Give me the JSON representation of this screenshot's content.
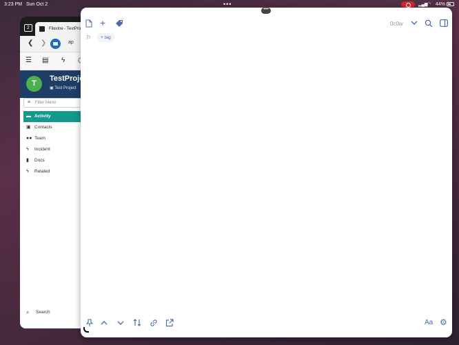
{
  "status_bar": {
    "time": "3:23 PM",
    "date": "Sun Oct 2",
    "battery": "44%",
    "recording_color": "#d3272b"
  },
  "browser": {
    "tab_count": "2",
    "tab_title": "Filevine - TestProje",
    "url_text": "ap",
    "project": {
      "avatar_letter": "T",
      "name": "TestProjec",
      "subtitle": "Test Project",
      "avatar_color": "#4caf50",
      "header_color": "#1e3e66"
    },
    "filter_placeholder": "Filter Menu",
    "menu": [
      {
        "label": "Activity",
        "icon": "chat-icon",
        "active": true
      },
      {
        "label": "Contacts",
        "icon": "contact-card-icon",
        "active": false
      },
      {
        "label": "Team",
        "icon": "people-icon",
        "active": false
      },
      {
        "label": "Incident",
        "icon": "bolt-icon",
        "active": false
      },
      {
        "label": "Docs",
        "icon": "document-icon",
        "active": false
      },
      {
        "label": "Related",
        "icon": "bolt-icon",
        "active": false
      }
    ],
    "search_label": "Search",
    "accent_color": "#129a8f"
  },
  "editor": {
    "word_count": "0c0w",
    "tag_button": "+ tag",
    "toolbar_top": [
      "new-document-icon",
      "plus-icon",
      "tag-icon"
    ],
    "toolbar_right": [
      "chevron-down-icon",
      "search-icon",
      "sidebar-icon"
    ],
    "toolbar_bottom": [
      "pin-icon",
      "arrow-up-icon",
      "arrow-down-icon",
      "sort-icon",
      "link-icon",
      "share-icon"
    ],
    "format_label": "Aa",
    "icon_color": "#4a6db0"
  }
}
